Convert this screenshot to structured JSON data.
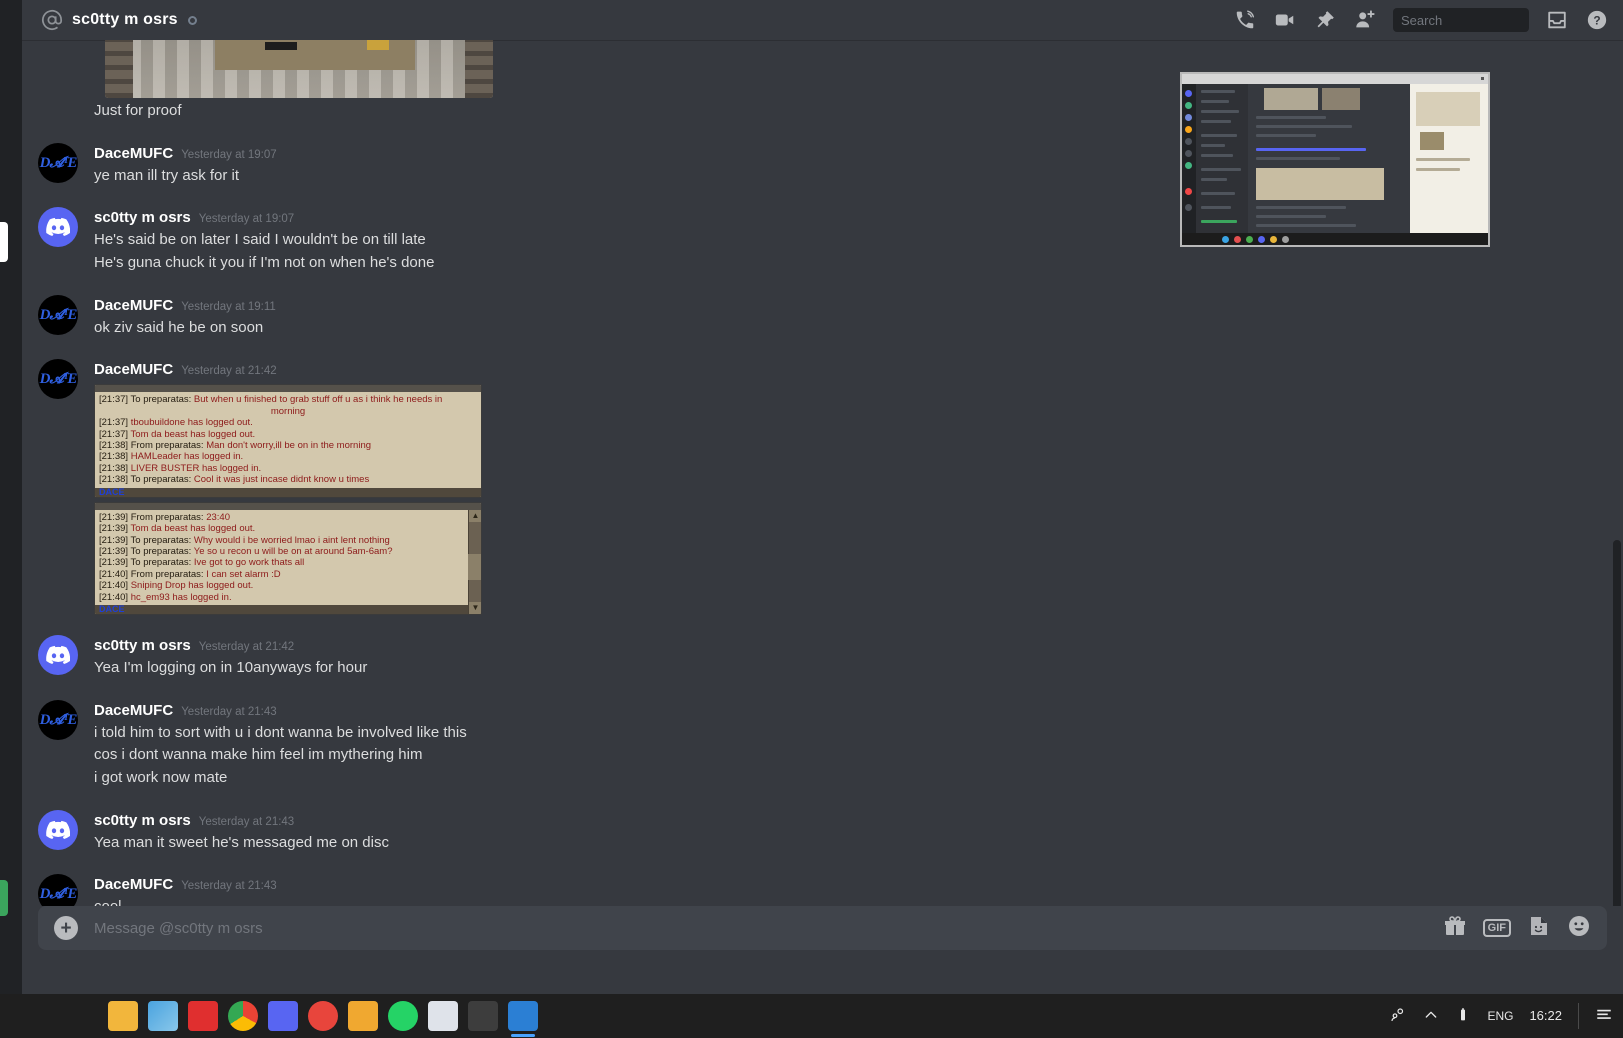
{
  "header": {
    "at_icon": "at-icon",
    "dm_name": "sc0tty m osrs",
    "icons": [
      "voice-call-icon",
      "video-call-icon",
      "pin-icon",
      "add-friend-icon",
      "inbox-icon",
      "help-icon"
    ]
  },
  "search": {
    "placeholder": "Search",
    "value": ""
  },
  "messages": [
    {
      "id": "m0",
      "author": null,
      "timestamp": null,
      "avatar": null,
      "attachment": "cropped-photo",
      "lines": [
        "Just for proof"
      ]
    },
    {
      "id": "m1",
      "author": "DaceMUFC",
      "timestamp": "Yesterday at 19:07",
      "avatar": "dace",
      "lines": [
        "ye man ill try ask for it"
      ]
    },
    {
      "id": "m2",
      "author": "sc0tty m osrs",
      "timestamp": "Yesterday at 19:07",
      "avatar": "scotty",
      "lines": [
        "He's said be on later I said I wouldn't be on till late",
        "He's guna chuck it you if I'm not on when he's done"
      ]
    },
    {
      "id": "m3",
      "author": "DaceMUFC",
      "timestamp": "Yesterday at 19:11",
      "avatar": "dace",
      "lines": [
        "ok ziv said he be on soon"
      ]
    },
    {
      "id": "m4",
      "author": "DaceMUFC",
      "timestamp": "Yesterday at 21:42",
      "avatar": "dace",
      "attachment": "rs-chat-images",
      "lines": []
    },
    {
      "id": "m5",
      "author": "sc0tty m osrs",
      "timestamp": "Yesterday at 21:42",
      "avatar": "scotty",
      "lines": [
        "Yea I'm logging on in 10anyways for hour"
      ]
    },
    {
      "id": "m6",
      "author": "DaceMUFC",
      "timestamp": "Yesterday at 21:43",
      "avatar": "dace",
      "lines": [
        "i told him to sort with u i dont wanna be involved like this",
        "cos i dont wanna make him feel im mythering him",
        "i got work now mate"
      ]
    },
    {
      "id": "m7",
      "author": "sc0tty m osrs",
      "timestamp": "Yesterday at 21:43",
      "avatar": "scotty",
      "lines": [
        "Yea man it sweet he's messaged me on disc"
      ]
    },
    {
      "id": "m8",
      "author": "DaceMUFC",
      "timestamp": "Yesterday at 21:43",
      "avatar": "dace",
      "lines": [
        "cool"
      ]
    }
  ],
  "rs_chat_1": {
    "lines": [
      {
        "time": "[21:37]",
        "text": "To preparatas: ",
        "msg": "But when u finished to grab stuff off u as i think he needs in",
        "color": "red"
      },
      {
        "time": "",
        "text": "",
        "msg": "morning",
        "color": "red",
        "center": true
      },
      {
        "time": "[21:37]",
        "text": "",
        "msg": "tboubuildone has logged out.",
        "color": "red"
      },
      {
        "time": "[21:37]",
        "text": "",
        "msg": "Tom da beast has logged out.",
        "color": "red"
      },
      {
        "time": "[21:38]",
        "text": "From preparatas: ",
        "msg": "Man don't worry,ill be on in the morning",
        "color": "red"
      },
      {
        "time": "[21:38]",
        "text": "",
        "msg": "HAMLeader has logged in.",
        "color": "red"
      },
      {
        "time": "[21:38]",
        "text": "",
        "msg": "LIVER BUSTER has logged in.",
        "color": "red"
      },
      {
        "time": "[21:38]",
        "text": "To preparatas: ",
        "msg": "Cool it was  just incase didnt know u times",
        "color": "red"
      }
    ],
    "footer_name": "DACE"
  },
  "rs_chat_2": {
    "lines": [
      {
        "time": "[21:39]",
        "text": "From preparatas: ",
        "msg": "23:40",
        "color": "red"
      },
      {
        "time": "[21:39]",
        "text": "",
        "msg": "Tom da beast has logged out.",
        "color": "red"
      },
      {
        "time": "[21:39]",
        "text": "To preparatas: ",
        "msg": "Why would i be worried lmao i aint lent nothing",
        "color": "red"
      },
      {
        "time": "[21:39]",
        "text": "To preparatas: ",
        "msg": "Ye so u recon u will be on at around 5am-6am?",
        "color": "red"
      },
      {
        "time": "[21:39]",
        "text": "To preparatas: ",
        "msg": "Ive got to go work thats all",
        "color": "red"
      },
      {
        "time": "[21:40]",
        "text": "From preparatas: ",
        "msg": "I can set alarm :D",
        "color": "red"
      },
      {
        "time": "[21:40]",
        "text": "",
        "msg": "Sniping Drop has logged out.",
        "color": "red"
      },
      {
        "time": "[21:40]",
        "text": "",
        "msg": "hc_em93 has logged in.",
        "color": "red"
      }
    ],
    "footer_name": "DACE"
  },
  "composer": {
    "placeholder": "Message @sc0tty m osrs",
    "value": "",
    "add_label": "+",
    "gif_label": "GIF",
    "icons": [
      "gift-icon",
      "gif-icon",
      "sticker-icon",
      "emoji-icon"
    ]
  },
  "taskbar": {
    "language": "ENG",
    "time": "16:22",
    "tray_icons": [
      "people-icon",
      "show-hidden-icons-icon",
      "battery-icon",
      "network-icon",
      "action-center-icon"
    ],
    "apps": [
      "file-explorer-taskbar-icon",
      "photos-taskbar-icon",
      "youtube-taskbar-icon",
      "chrome-taskbar-icon",
      "discord-taskbar-icon",
      "media-taskbar-icon",
      "folder-taskbar-icon",
      "whatsapp-taskbar-icon",
      "calculator-taskbar-icon",
      "runelite-taskbar-icon",
      "snip-taskbar-icon"
    ]
  },
  "colors": {
    "blurple": "#5865f2",
    "bg_primary": "#36393f",
    "bg_secondary": "#2f3136",
    "bg_tertiary": "#202225",
    "text_normal": "#dcddde",
    "text_muted": "#72767d",
    "green_status": "#3ba55d"
  }
}
